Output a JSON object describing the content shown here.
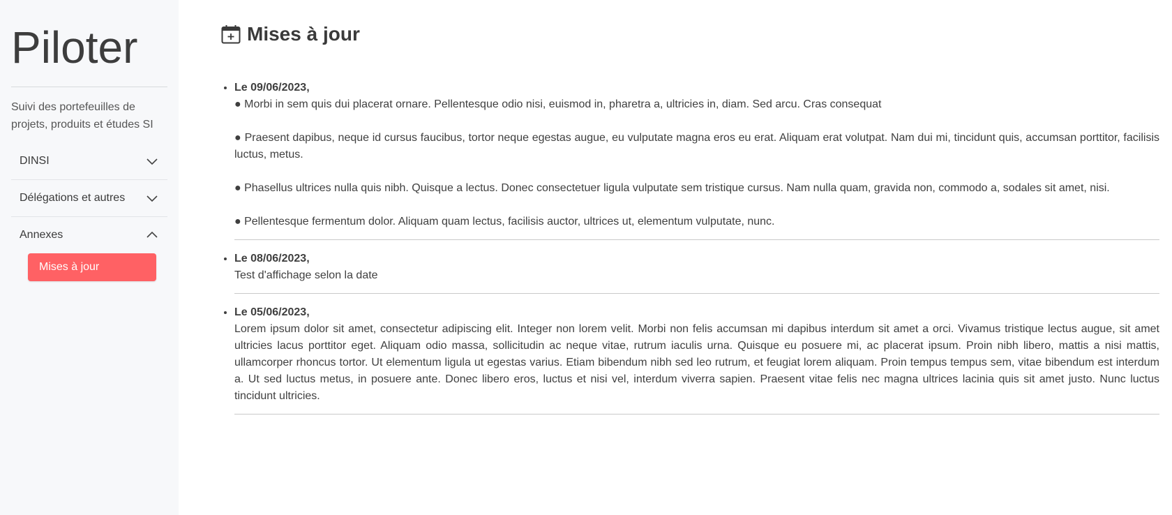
{
  "sidebar": {
    "brand": "Piloter",
    "subtitle": "Suivi des portefeuilles de projets, produits et études SI",
    "groups": [
      {
        "label": "DINSI",
        "expanded": false
      },
      {
        "label": "Délégations et autres",
        "expanded": false
      },
      {
        "label": "Annexes",
        "expanded": true,
        "items": [
          {
            "label": "Mises à jour",
            "active": true
          }
        ]
      }
    ],
    "active_color": "#ff6164"
  },
  "main": {
    "title": "Mises à jour",
    "title_icon": "calendar-plus-icon",
    "updates": [
      {
        "date": "Le 09/06/2023,",
        "paragraphs": [
          "● Morbi in sem quis dui placerat ornare. Pellentesque odio nisi, euismod in, pharetra a, ultricies in, diam. Sed arcu. Cras consequat",
          "● Praesent dapibus, neque id cursus faucibus, tortor neque egestas augue, eu vulputate magna eros eu erat. Aliquam erat volutpat. Nam dui mi, tincidunt quis, accumsan porttitor, facilisis luctus, metus.",
          "● Phasellus ultrices nulla quis nibh. Quisque a lectus. Donec consectetuer ligula vulputate sem tristique cursus. Nam nulla quam, gravida non, commodo a, sodales sit amet, nisi.",
          "● Pellentesque fermentum dolor. Aliquam quam lectus, facilisis auctor, ultrices ut, elementum vulputate, nunc."
        ]
      },
      {
        "date": "Le 08/06/2023,",
        "paragraphs": [
          "Test d'affichage selon la date"
        ]
      },
      {
        "date": "Le 05/06/2023,",
        "paragraphs": [
          "Lorem ipsum dolor sit amet, consectetur adipiscing elit. Integer non lorem velit. Morbi non felis accumsan mi dapibus interdum sit amet a orci. Vivamus tristique lectus augue, sit amet ultricies lacus porttitor eget. Aliquam odio massa, sollicitudin ac neque vitae, rutrum iaculis urna. Quisque eu posuere mi, ac placerat ipsum. Proin nibh libero, mattis a nisi mattis, ullamcorper rhoncus tortor. Ut elementum ligula ut egestas varius. Etiam bibendum nibh sed leo rutrum, et feugiat lorem aliquam. Proin tempus tempus sem, vitae bibendum est interdum a. Ut sed luctus metus, in posuere ante. Donec libero eros, luctus et nisi vel, interdum viverra sapien. Praesent vitae felis nec magna ultrices lacinia quis sit amet justo. Nunc luctus tincidunt ultricies."
        ]
      }
    ]
  }
}
